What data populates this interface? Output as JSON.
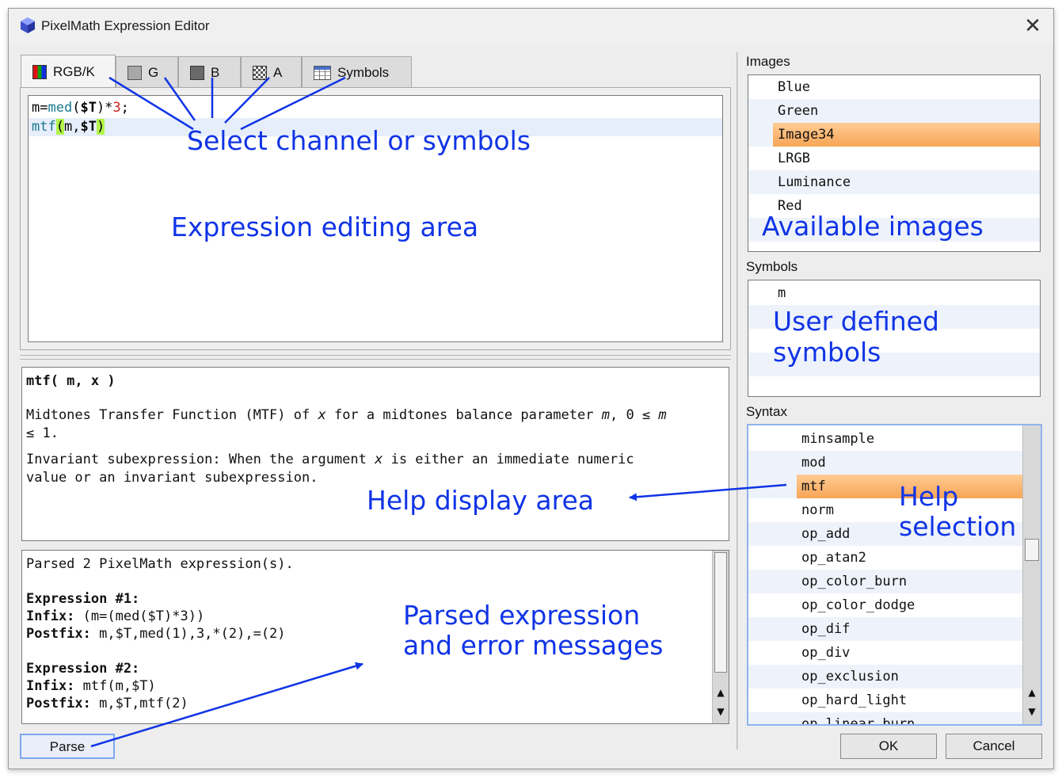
{
  "window": {
    "title": "PixelMath Expression Editor",
    "close_glyph": "✕"
  },
  "tabs": [
    {
      "label": "RGB/K",
      "icon": "rgb-channel-icon"
    },
    {
      "label": "G",
      "icon": "green-channel-icon"
    },
    {
      "label": "B",
      "icon": "blue-channel-icon"
    },
    {
      "label": "A",
      "icon": "alpha-channel-icon"
    },
    {
      "label": "Symbols",
      "icon": "table-icon"
    }
  ],
  "editor": {
    "line1": {
      "p1": "m=",
      "p2": "med",
      "p3": "(",
      "p4": "$T",
      "p5": ")*",
      "p6": "3",
      "p7": ";"
    },
    "line2": {
      "p1": "mtf",
      "p2": "(",
      "p3": "m,",
      "p4": "$T",
      "p5": ")"
    }
  },
  "help": {
    "signature": "mtf( m, x )",
    "desc_a": "Midtones Transfer Function (MTF) of ",
    "desc_b": "x",
    "desc_c": " for a midtones balance parameter ",
    "desc_d": "m",
    "desc_e": ", 0 ≤ ",
    "desc_f": "m",
    "desc_g": "≤ 1.",
    "inv_a": "Invariant subexpression: When the argument ",
    "inv_b": "x",
    "inv_c": " is either an immediate numeric",
    "inv_d": "value or an invariant subexpression."
  },
  "parse_output": {
    "summary": "Parsed 2 PixelMath expression(s).",
    "expr1_header": "Expression #1:",
    "expr1_infix_label": "Infix:",
    "expr1_infix": " (m=(med($T)*3))",
    "expr1_postfix_label": "Postfix:",
    "expr1_postfix": " m,$T,med(1),3,*(2),=(2)",
    "expr2_header": "Expression #2:",
    "expr2_infix_label": "Infix:",
    "expr2_infix": " mtf(m,$T)",
    "expr2_postfix_label": "Postfix:",
    "expr2_postfix": " m,$T,mtf(2)"
  },
  "images_panel": {
    "label": "Images",
    "items": [
      "Blue",
      "Green",
      "Image34",
      "LRGB",
      "Luminance",
      "Red"
    ],
    "selected": "Image34"
  },
  "symbols_panel": {
    "label": "Symbols",
    "items": [
      "m"
    ]
  },
  "syntax_panel": {
    "label": "Syntax",
    "items": [
      "minsample",
      "mod",
      "mtf",
      "norm",
      "op_add",
      "op_atan2",
      "op_color_burn",
      "op_color_dodge",
      "op_dif",
      "op_div",
      "op_exclusion",
      "op_hard_light",
      "op_linear_burn"
    ],
    "selected": "mtf"
  },
  "buttons": {
    "parse": "Parse",
    "ok": "OK",
    "cancel": "Cancel"
  },
  "annotations": {
    "select_channel": "Select channel or symbols",
    "expression_area": "Expression editing area",
    "available_images": "Available images",
    "user_symbols_1": "User defined",
    "user_symbols_2": "symbols",
    "help_display": "Help display area",
    "help_selection_1": "Help",
    "help_selection_2": "selection",
    "parsed_1": "Parsed expression",
    "parsed_2": "and error messages"
  },
  "colors": {
    "accent": "#1034e6",
    "selection": "#f7a556",
    "bracket_highlight": "#b3f44a",
    "function_teal": "#1a7a8c",
    "number_red": "#c81e1e"
  }
}
